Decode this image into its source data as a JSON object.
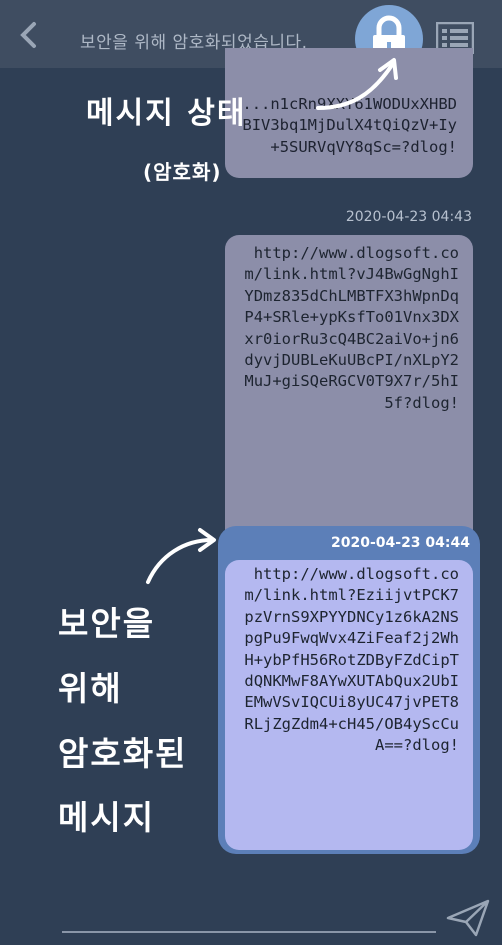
{
  "header": {
    "title": "보안을 위해 암호화되었습니다.",
    "back_icon": "back-chevron-icon",
    "lock_icon": "lock-icon",
    "menu_icon": "list-menu-icon",
    "lock_color": "#7fa6d6"
  },
  "messages": [
    {
      "timestamp": "",
      "text": "...n1cRn9XXY61WODUxXHBDBIV3bq1MjDulX4tQiQzV+Iy+5SURVqVY8qSc=?dlog!"
    },
    {
      "timestamp": "2020-04-23 04:43",
      "text": "http://www.dlogsoft.com/link.html?vJ4BwGgNghIYDmz835dChLMBTFX3hWpnDqP4+SRle+ypKsfTo01Vnx3DXxr0iorRu3cQ4BC2aiVo+jn6dyvjDUBLeKuUBcPI/nXLpY2MuJ+giSQeRGCV0T9X7r/5hI5f?dlog!"
    },
    {
      "timestamp": "2020-04-23 04:44",
      "text": "http://www.dlogsoft.com/link.html?EziijvtPCK7pzVrnS9XPYYDNCy1z6kA2NSpgPu9FwqWvx4ZiFeaf2j2WhH+ybPfH56RotZDByFZdCipTdQNKMwF8AYwXUTAbQux2UbIEMwVSvIQCUi8yUC47jvPET8RLjZgZdm4+cH45/OB4yScCuA==?dlog!"
    }
  ],
  "annotations": {
    "status_label": "메시지 상태",
    "status_sub": "(암호화)",
    "encrypted_lines": [
      "보안을",
      "위해",
      "암호화된",
      "메시지"
    ]
  },
  "input": {
    "send_icon": "send-icon"
  }
}
